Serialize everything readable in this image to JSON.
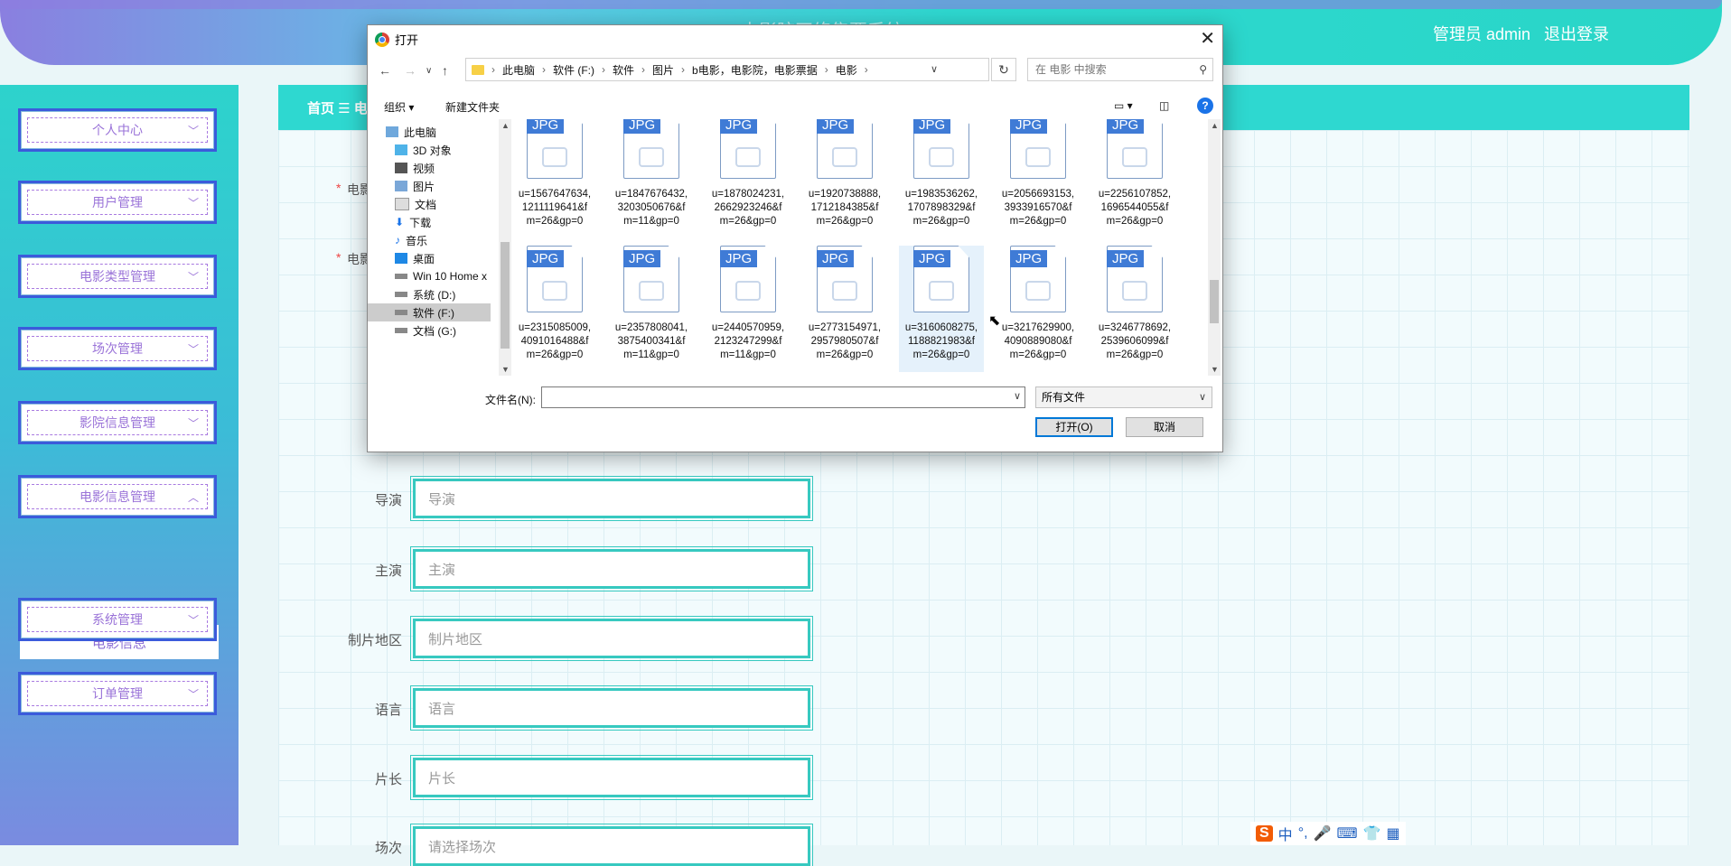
{
  "app": {
    "title": "电影院网络售票系统",
    "user_label": "管理员 admin",
    "logout": "退出登录"
  },
  "sidebar": {
    "items": [
      {
        "label": "个人中心"
      },
      {
        "label": "用户管理"
      },
      {
        "label": "电影类型管理"
      },
      {
        "label": "场次管理"
      },
      {
        "label": "影院信息管理"
      },
      {
        "label": "电影信息管理"
      },
      {
        "label": "系统管理"
      },
      {
        "label": "订单管理"
      }
    ],
    "sub_item": "电影信息"
  },
  "breadcrumb": {
    "home": "首页",
    "icon": "menu-icon",
    "current": "电"
  },
  "form": {
    "partial_labels": [
      "电影",
      "电影"
    ],
    "fields": [
      {
        "label": "导演",
        "placeholder": "导演"
      },
      {
        "label": "主演",
        "placeholder": "主演"
      },
      {
        "label": "制片地区",
        "placeholder": "制片地区"
      },
      {
        "label": "语言",
        "placeholder": "语言"
      },
      {
        "label": "片长",
        "placeholder": "片长"
      },
      {
        "label": "场次",
        "placeholder": "请选择场次"
      }
    ]
  },
  "dialog": {
    "title": "打开",
    "path": [
      "此电脑",
      "软件 (F:)",
      "软件",
      "图片",
      "b电影，电影院，电影票据",
      "电影"
    ],
    "search_placeholder": "在 电影 中搜索",
    "organize": "组织 ▾",
    "new_folder": "新建文件夹",
    "nav": [
      {
        "label": "此电脑",
        "icon": "computer-icon"
      },
      {
        "label": "3D 对象",
        "icon": "cube-icon"
      },
      {
        "label": "视频",
        "icon": "video-icon"
      },
      {
        "label": "图片",
        "icon": "pictures-icon"
      },
      {
        "label": "文档",
        "icon": "document-icon"
      },
      {
        "label": "下载",
        "icon": "download-icon"
      },
      {
        "label": "音乐",
        "icon": "music-icon"
      },
      {
        "label": "桌面",
        "icon": "desktop-icon"
      },
      {
        "label": "Win 10 Home x",
        "icon": "drive-icon"
      },
      {
        "label": "系统 (D:)",
        "icon": "drive-icon"
      },
      {
        "label": "软件 (F:)",
        "icon": "drive-icon"
      },
      {
        "label": "文档 (G:)",
        "icon": "drive-icon"
      }
    ],
    "file_tag": "JPG",
    "files_row1": [
      [
        "u=1567647634,",
        "1211119641&f",
        "m=26&gp=0"
      ],
      [
        "u=1847676432,",
        "3203050676&f",
        "m=11&gp=0"
      ],
      [
        "u=1878024231,",
        "2662923246&f",
        "m=26&gp=0"
      ],
      [
        "u=1920738888,",
        "1712184385&f",
        "m=26&gp=0"
      ],
      [
        "u=1983536262,",
        "1707898329&f",
        "m=26&gp=0"
      ],
      [
        "u=2056693153,",
        "3933916570&f",
        "m=26&gp=0"
      ],
      [
        "u=2256107852,",
        "1696544055&f",
        "m=26&gp=0"
      ]
    ],
    "files_row2": [
      [
        "u=2315085009,",
        "4091016488&f",
        "m=26&gp=0"
      ],
      [
        "u=2357808041,",
        "3875400341&f",
        "m=11&gp=0"
      ],
      [
        "u=2440570959,",
        "2123247299&f",
        "m=11&gp=0"
      ],
      [
        "u=2773154971,",
        "2957980507&f",
        "m=26&gp=0"
      ],
      [
        "u=3160608275,",
        "1188821983&f",
        "m=26&gp=0"
      ],
      [
        "u=3217629900,",
        "4090889080&f",
        "m=26&gp=0"
      ],
      [
        "u=3246778692,",
        "2539606099&f",
        "m=26&gp=0"
      ]
    ],
    "selected_index_row2": 4,
    "filename_label": "文件名(N):",
    "filename_value": "",
    "filetype": "所有文件",
    "open": "打开(O)",
    "cancel": "取消"
  },
  "ime": {
    "logo": "S",
    "mode": "中",
    "icons": [
      "punct-icon",
      "mic-icon",
      "keyboard-icon",
      "skin-icon",
      "grid-icon"
    ]
  }
}
